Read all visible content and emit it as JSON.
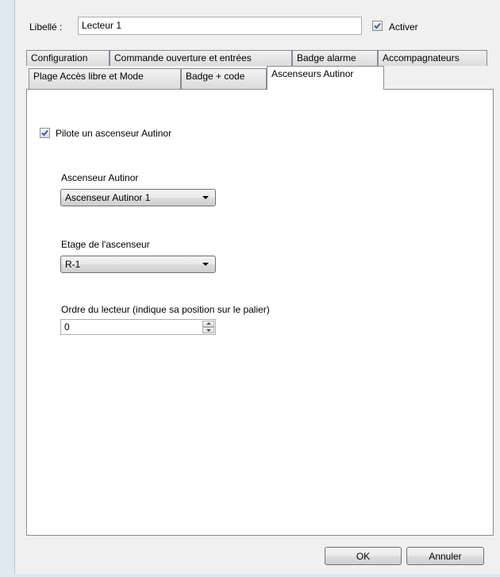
{
  "header": {
    "label_caption": "Libellé :",
    "label_value": "Lecteur 1",
    "activate_label": "Activer",
    "activate_checked": true
  },
  "tabs": {
    "row1": [
      "Configuration",
      "Commande ouverture et entrées",
      "Badge alarme",
      "Accompagnateurs"
    ],
    "row2": [
      "Plage Accès libre et Mode",
      "Badge + code",
      "Ascenseurs Autinor"
    ],
    "active": "Ascenseurs Autinor"
  },
  "panel": {
    "pilot_checkbox_label": "Pilote un ascenseur Autinor",
    "pilot_checked": true,
    "elevator_label": "Ascenseur Autinor",
    "elevator_value": "Ascenseur Autinor 1",
    "floor_label": "Etage de l'ascenseur",
    "floor_value": "R-1",
    "order_label": "Ordre du lecteur (indique sa position sur le palier)",
    "order_value": "0"
  },
  "footer": {
    "ok_label": "OK",
    "cancel_label": "Annuler"
  },
  "colors": {
    "check_mark": "#3a5fa8",
    "background": "#f0f0f0",
    "panel": "#ffffff"
  }
}
